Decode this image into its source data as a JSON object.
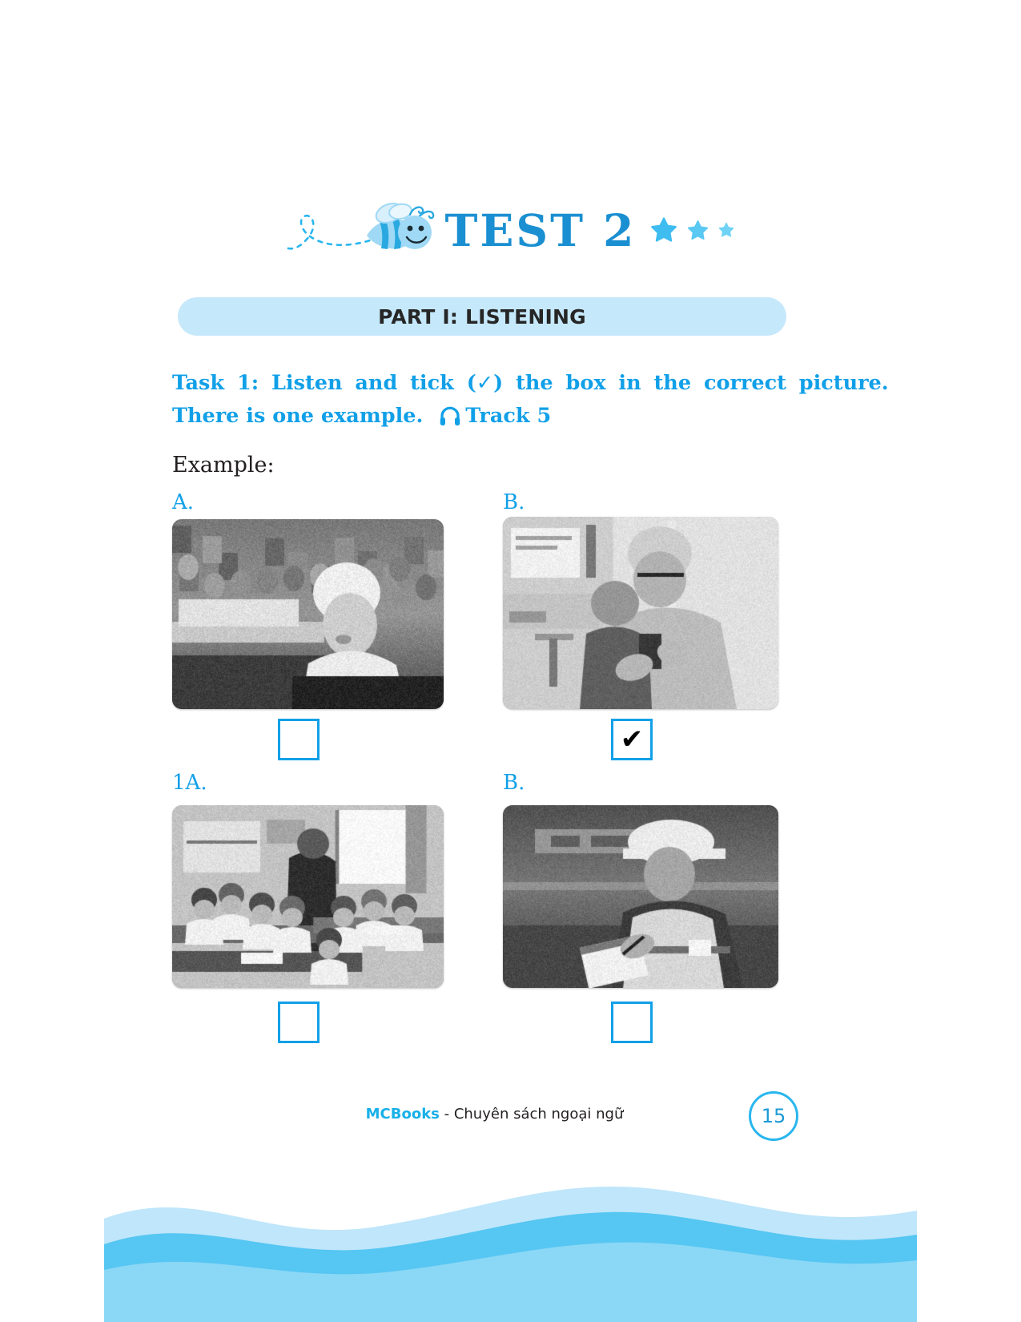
{
  "header": {
    "test_title": "TEST 2",
    "bee_icon": "bee-icon",
    "star_count": 3,
    "accent_color": "#1a8fd1"
  },
  "part_banner": {
    "text": "PART I: LISTENING",
    "background": "#c6e8fb"
  },
  "task": {
    "line1": "Task 1: Listen and tick (✓) the box in the correct picture.",
    "line1_before_tick": "Task 1: Listen and tick (",
    "tick_symbol": "✓",
    "line1_after_tick": ") the box in the correct picture.",
    "line2_before_icon": "There is one example.",
    "headphone_icon": "headphone-icon",
    "track_label": "Track 5",
    "color": "#11a0e8"
  },
  "example": {
    "label": "Example:"
  },
  "questions": [
    {
      "id": "example",
      "options": [
        {
          "letter": "A.",
          "checked": false,
          "tick": "",
          "photo_alt": "woman working at a sewing machine in a garment factory"
        },
        {
          "letter": "B.",
          "checked": true,
          "tick": "✔",
          "photo_alt": "man in medical scrubs holding a child and looking at a phone"
        }
      ]
    },
    {
      "id": "1",
      "options": [
        {
          "letter": "1A.",
          "checked": false,
          "tick": "",
          "photo_alt": "teacher walking among pupils at desks in a classroom"
        },
        {
          "letter": "B.",
          "checked": false,
          "tick": "",
          "photo_alt": "construction worker in hard hat and hi-vis vest writing on a clipboard"
        }
      ]
    }
  ],
  "footer": {
    "brand": "MCBooks",
    "tagline": " - Chuyên sách ngoại ngữ",
    "page_number": "15",
    "wave_color_light": "#bfe6fa",
    "wave_color_dark": "#56c6f2"
  }
}
